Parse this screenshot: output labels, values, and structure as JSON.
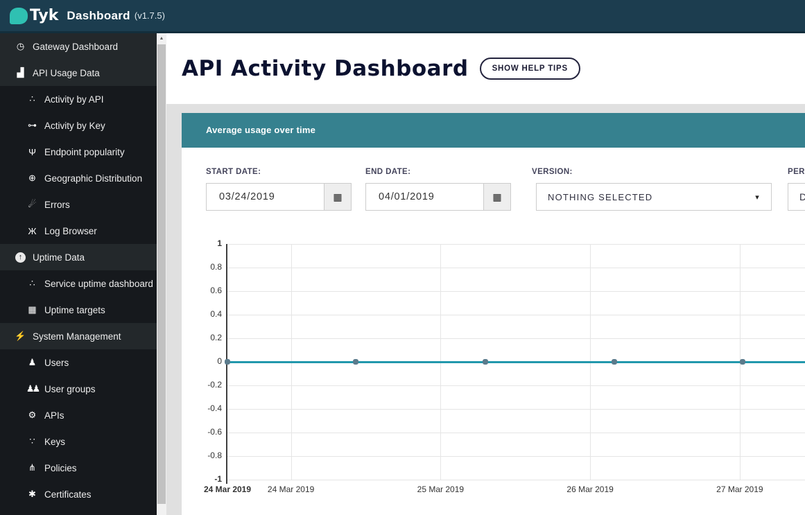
{
  "topbar": {
    "brand": "Tyk",
    "product": "Dashboard",
    "version": "(v1.7.5)"
  },
  "sidebar": {
    "items": [
      {
        "label": "Gateway Dashboard",
        "icon": "tachometer-icon",
        "level": "top"
      },
      {
        "label": "API Usage Data",
        "icon": "bar-chart-icon",
        "level": "top"
      },
      {
        "label": "Activity by API",
        "icon": "cluster-icon",
        "level": "sub"
      },
      {
        "label": "Activity by Key",
        "icon": "key-icon",
        "level": "sub"
      },
      {
        "label": "Endpoint popularity",
        "icon": "code-branch-icon",
        "level": "sub"
      },
      {
        "label": "Geographic Distribution",
        "icon": "globe-icon",
        "level": "sub"
      },
      {
        "label": "Errors",
        "icon": "bomb-icon",
        "level": "sub"
      },
      {
        "label": "Log Browser",
        "icon": "bug-icon",
        "level": "sub"
      },
      {
        "label": "Uptime Data",
        "icon": "arrow-up-circle-icon",
        "level": "top"
      },
      {
        "label": "Service uptime dashboard",
        "icon": "cluster-icon",
        "level": "sub"
      },
      {
        "label": "Uptime targets",
        "icon": "table-icon",
        "level": "sub"
      },
      {
        "label": "System Management",
        "icon": "bolt-icon",
        "level": "top"
      },
      {
        "label": "Users",
        "icon": "user-icon",
        "level": "sub"
      },
      {
        "label": "User groups",
        "icon": "users-icon",
        "level": "sub"
      },
      {
        "label": "APIs",
        "icon": "cogs-icon",
        "level": "sub"
      },
      {
        "label": "Keys",
        "icon": "sitemap-icon",
        "level": "sub"
      },
      {
        "label": "Policies",
        "icon": "plug-icon",
        "level": "sub"
      },
      {
        "label": "Certificates",
        "icon": "certificate-icon",
        "level": "sub"
      }
    ]
  },
  "header": {
    "title": "API Activity Dashboard",
    "help_button_label": "SHOW HELP TIPS"
  },
  "panel": {
    "title": "Average usage over time"
  },
  "filters": {
    "start_date": {
      "label": "START DATE:",
      "value": "03/24/2019",
      "icon": "calendar-icon"
    },
    "end_date": {
      "label": "END DATE:",
      "value": "04/01/2019",
      "icon": "calendar-icon"
    },
    "version": {
      "label": "VERSION:",
      "value": "NOTHING SELECTED",
      "icon": "caret-down-icon"
    },
    "period": {
      "label": "PERIOD:",
      "value": "Daily"
    }
  },
  "chart_data": {
    "type": "line",
    "title": "Average usage over time",
    "xlabel": "",
    "ylabel": "",
    "ylim": [
      -1,
      1
    ],
    "grid": true,
    "legend": "none",
    "y_ticks": [
      "1",
      "0.8",
      "0.6",
      "0.4",
      "0.2",
      "0",
      "-0.2",
      "-0.4",
      "-0.6",
      "-0.8",
      "-1"
    ],
    "x_tick_labels": [
      "24 Mar 2019",
      "24 Mar 2019",
      "25 Mar 2019",
      "26 Mar 2019",
      "27 Mar 2019"
    ],
    "x_tick_fracs": [
      0,
      0.11,
      0.369,
      0.628,
      0.887
    ],
    "x_gridline_fracs": [
      0.11,
      0.369,
      0.628,
      0.887
    ],
    "series": [
      {
        "name": "Average usage",
        "y_values": [
          0,
          0,
          0,
          0,
          0
        ],
        "marker_x_fracs": [
          0,
          0.222,
          0.447,
          0.67,
          0.892
        ]
      }
    ],
    "line_color": "#2298ac",
    "marker_color": "#5b7b8c"
  },
  "colors": {
    "topbar_bg": "#1c3d4f",
    "logo_teal": "#2fc0b2",
    "sidebar_top_bg": "#23282b",
    "sidebar_sub_bg": "#16191d",
    "content_bg": "#e0e0e0",
    "panel_header_bg": "#36818f",
    "chart_line": "#2298ac",
    "chart_marker": "#5b7b8c"
  }
}
